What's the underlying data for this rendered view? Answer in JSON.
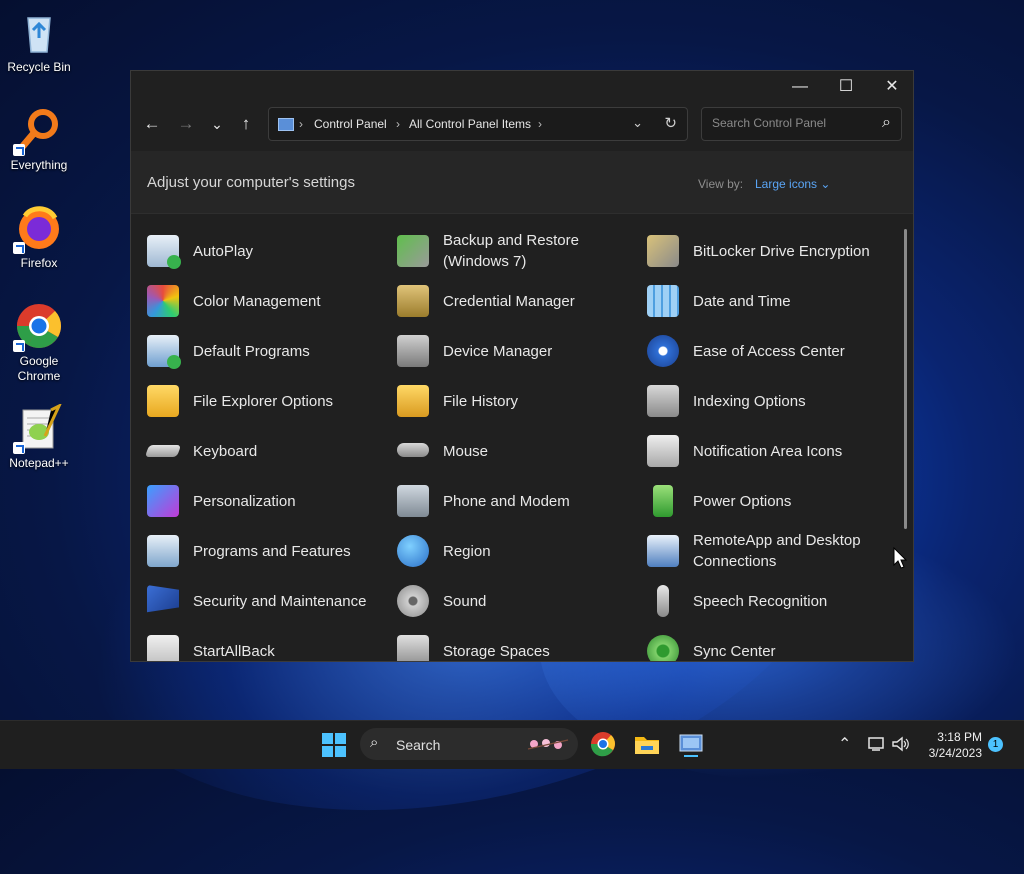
{
  "desktop": {
    "icons": [
      {
        "label": "Recycle Bin",
        "icon": "recycle-bin-icon"
      },
      {
        "label": "Everything",
        "icon": "everything-icon"
      },
      {
        "label": "Firefox",
        "icon": "firefox-icon"
      },
      {
        "label": "Google Chrome",
        "icon": "chrome-icon"
      },
      {
        "label": "Notepad++",
        "icon": "notepad-plus-plus-icon"
      }
    ]
  },
  "window": {
    "title_buttons": {
      "minimize": "—",
      "maximize": "☐",
      "close": "✕"
    },
    "nav": {
      "back": "←",
      "forward": "→",
      "recent": "⌄",
      "up": "↑"
    },
    "address": {
      "crumbs": [
        "Control Panel",
        "All Control Panel Items"
      ],
      "separator": "›"
    },
    "search": {
      "placeholder": "Search Control Panel"
    },
    "header": {
      "title": "Adjust your computer's settings",
      "view_by_label": "View by:",
      "view_by_value": "Large icons ⌄"
    },
    "items": [
      {
        "label": "AutoPlay",
        "icon": "autoplay-icon"
      },
      {
        "label": "Backup and Restore (Windows 7)",
        "icon": "backup-restore-icon"
      },
      {
        "label": "BitLocker Drive Encryption",
        "icon": "bitlocker-icon"
      },
      {
        "label": "Color Management",
        "icon": "color-management-icon"
      },
      {
        "label": "Credential Manager",
        "icon": "credential-manager-icon"
      },
      {
        "label": "Date and Time",
        "icon": "date-time-icon"
      },
      {
        "label": "Default Programs",
        "icon": "default-programs-icon"
      },
      {
        "label": "Device Manager",
        "icon": "device-manager-icon"
      },
      {
        "label": "Ease of Access Center",
        "icon": "ease-of-access-icon"
      },
      {
        "label": "File Explorer Options",
        "icon": "file-explorer-options-icon"
      },
      {
        "label": "File History",
        "icon": "file-history-icon"
      },
      {
        "label": "Indexing Options",
        "icon": "indexing-options-icon"
      },
      {
        "label": "Keyboard",
        "icon": "keyboard-icon"
      },
      {
        "label": "Mouse",
        "icon": "mouse-icon"
      },
      {
        "label": "Notification Area Icons",
        "icon": "notification-area-icon"
      },
      {
        "label": "Personalization",
        "icon": "personalization-icon"
      },
      {
        "label": "Phone and Modem",
        "icon": "phone-modem-icon"
      },
      {
        "label": "Power Options",
        "icon": "power-options-icon"
      },
      {
        "label": "Programs and Features",
        "icon": "programs-features-icon"
      },
      {
        "label": "Region",
        "icon": "region-icon"
      },
      {
        "label": "RemoteApp and Desktop Connections",
        "icon": "remoteapp-icon"
      },
      {
        "label": "Security and Maintenance",
        "icon": "security-maintenance-icon"
      },
      {
        "label": "Sound",
        "icon": "sound-icon"
      },
      {
        "label": "Speech Recognition",
        "icon": "speech-recognition-icon"
      },
      {
        "label": "StartAllBack",
        "icon": "startallback-icon"
      },
      {
        "label": "Storage Spaces",
        "icon": "storage-spaces-icon"
      },
      {
        "label": "Sync Center",
        "icon": "sync-center-icon"
      }
    ]
  },
  "taskbar": {
    "search_label": "Search",
    "apps": [
      "chrome-icon",
      "file-explorer-icon",
      "control-panel-icon"
    ],
    "clock": {
      "time": "3:18 PM",
      "date": "3/24/2023"
    },
    "notification_count": "1"
  },
  "colors": {
    "accent": "#5aa5f5",
    "window_bg": "#202020",
    "taskbar_bg": "#1f1f1f"
  }
}
